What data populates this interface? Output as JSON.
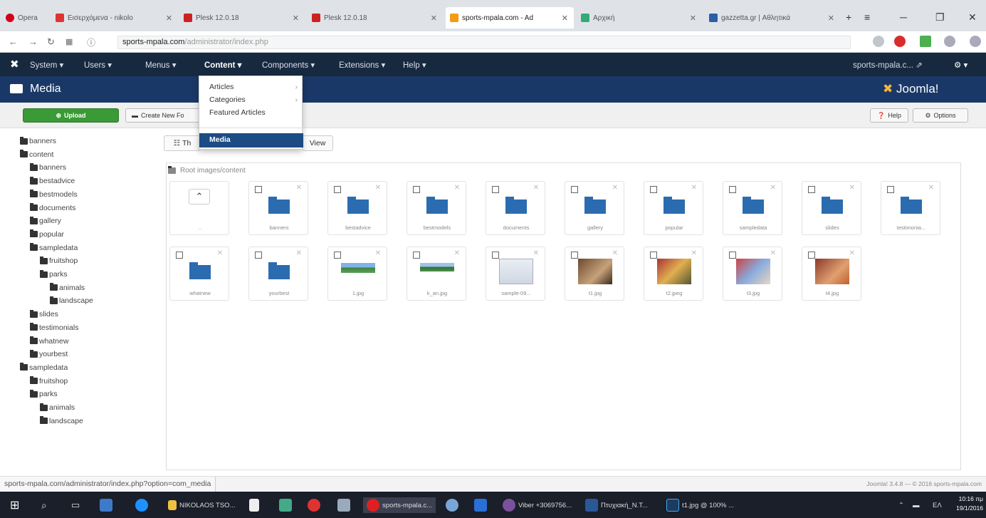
{
  "browser": {
    "tabs": [
      {
        "label": "Opera"
      },
      {
        "label": "Εισερχόμενα - nikolo"
      },
      {
        "label": "Plesk 12.0.18"
      },
      {
        "label": "Plesk 12.0.18"
      },
      {
        "label": "sports-mpala.com - Ad"
      },
      {
        "label": "Αρχική"
      },
      {
        "label": "gazzetta.gr | Αθλητικά"
      }
    ],
    "url_domain": "sports-mpala.com",
    "url_path": "/administrator/index.php"
  },
  "joomla": {
    "menu": [
      "System ▾",
      "Users ▾",
      "Menus ▾",
      "Content ▾",
      "Components ▾",
      "Extensions ▾",
      "Help ▾"
    ],
    "site_link": "sports-mpala.c... ⇗",
    "settings": "⚙ ▾",
    "page_title": "Media",
    "logo_text": "Joomla!",
    "toolbar": {
      "upload": "Upload",
      "create_folder": "Create New Fo",
      "help": "Help",
      "options": "Options"
    },
    "dropdown": [
      "Articles",
      "Categories",
      "Featured Articles",
      "Media"
    ],
    "view_thumbnail": "Th",
    "view_detail": "View",
    "breadcrumb": "Root images/content",
    "tree": [
      "banners",
      "content",
      "banners",
      "bestadvice",
      "bestmodels",
      "documents",
      "gallery",
      "popular",
      "sampledata",
      "fruitshop",
      "parks",
      "animals",
      "landscape",
      "slides",
      "testimonials",
      "whatnew",
      "yourbest",
      "sampledata",
      "fruitshop",
      "parks",
      "animals",
      "landscape"
    ],
    "items": [
      "..",
      "banners",
      "bestadvice",
      "bestmodels",
      "documents",
      "gallery",
      "popular",
      "sampledata",
      "slides",
      "testimonia...",
      "whatnew",
      "yourbest",
      "1.jpg",
      "k_an.jpg",
      "sample-09...",
      "t1.jpg",
      "t2.jpeg",
      "t3.jpg",
      "t4.jpg"
    ]
  },
  "status": {
    "link": "sports-mpala.com/administrator/index.php?option=com_media",
    "version": "Joomla! 3.4.8 — © 2016 sports-mpala.com"
  },
  "taskbar": {
    "items": [
      "NIKOLAOS TSO...",
      "sports-mpala.c...",
      "Viber +3069756...",
      "Πτυχιακή_Ν.Τ...",
      "t1.jpg @ 100% ..."
    ],
    "lang": "ΕΛ",
    "time": "10:16 πμ",
    "date": "19/1/2016"
  }
}
